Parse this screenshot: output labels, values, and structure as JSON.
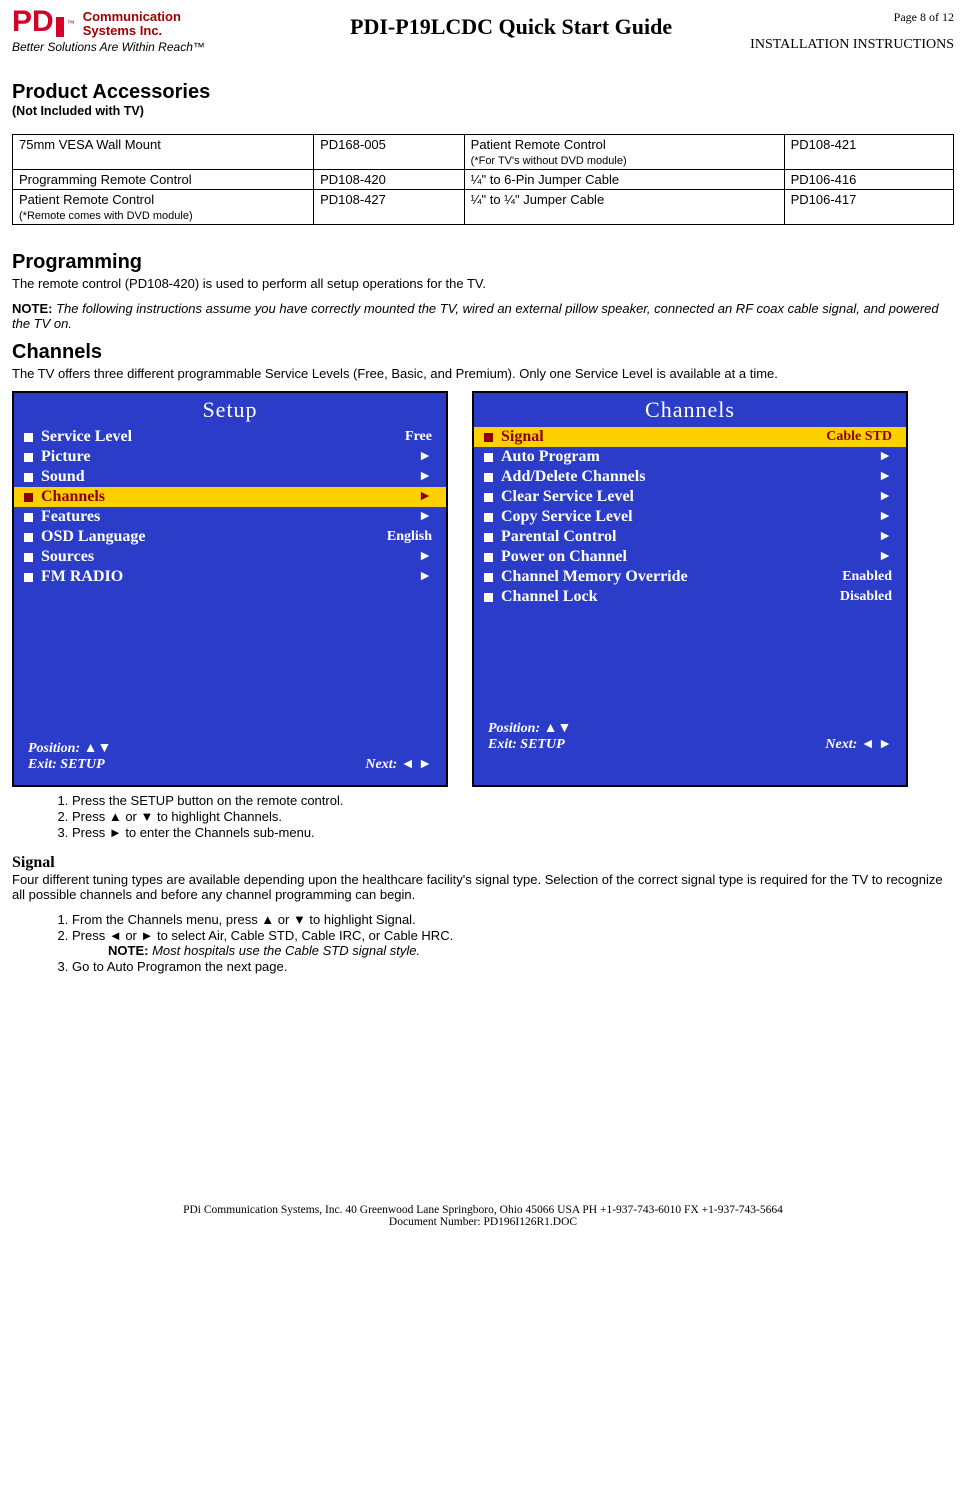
{
  "header": {
    "brand_line1": "Communication",
    "brand_line2": "Systems Inc.",
    "tagline": "Better Solutions Are Within Reach™",
    "title": "PDI-P19LCDC Quick Start Guide",
    "page": "Page 8 of 12",
    "section": "INSTALLATION INSTRUCTIONS"
  },
  "accessories": {
    "heading": "Product Accessories",
    "subheading": "(Not Included with TV)",
    "rows": [
      {
        "c0_name": "75mm VESA Wall Mount",
        "c0_note": "",
        "c1": "PD168-005",
        "c2_name": "Patient Remote Control",
        "c2_note": "(*For TV's without DVD module)",
        "c3": "PD108-421"
      },
      {
        "c0_name": "Programming Remote Control",
        "c0_note": "",
        "c1": "PD108-420",
        "c2_name": "¼\" to 6-Pin Jumper Cable",
        "c2_note": "",
        "c3": "PD106-416"
      },
      {
        "c0_name": "Patient Remote Control",
        "c0_note": "(*Remote comes with DVD module)",
        "c1": "PD108-427",
        "c2_name": "¼\" to ¼\" Jumper Cable",
        "c2_note": "",
        "c3": "PD106-417"
      }
    ]
  },
  "programming": {
    "heading": "Programming",
    "text": "The remote control (PD108-420) is used to perform all setup operations for the TV.",
    "note_label": "NOTE:",
    "note_text": "The following instructions assume you have correctly mounted the TV, wired an external pillow speaker, connected an RF coax cable signal, and powered the TV on."
  },
  "channels": {
    "heading": "Channels",
    "text": "The TV offers three different programmable Service Levels (Free, Basic, and Premium). Only one Service Level is available at a time."
  },
  "setup_menu": {
    "title": "Setup",
    "items": [
      {
        "label": "Service Level",
        "value": "Free",
        "highlight": false
      },
      {
        "label": "Picture",
        "value": "►",
        "highlight": false
      },
      {
        "label": "Sound",
        "value": "►",
        "highlight": false
      },
      {
        "label": "Channels",
        "value": "►",
        "highlight": true
      },
      {
        "label": "Features",
        "value": "►",
        "highlight": false
      },
      {
        "label": "OSD Language",
        "value": "English",
        "highlight": false
      },
      {
        "label": "Sources",
        "value": "►",
        "highlight": false
      },
      {
        "label": "FM RADIO",
        "value": "►",
        "highlight": false
      }
    ],
    "footer_pos": "Position: ▲▼",
    "footer_exit": "Exit: SETUP",
    "footer_next": "Next: ◄ ►"
  },
  "channels_menu": {
    "title": "Channels",
    "items": [
      {
        "label": "Signal",
        "value": "Cable STD",
        "highlight": true
      },
      {
        "label": "Auto Program",
        "value": "►",
        "highlight": false
      },
      {
        "label": "Add/Delete Channels",
        "value": "►",
        "highlight": false
      },
      {
        "label": "Clear Service Level",
        "value": "►",
        "highlight": false
      },
      {
        "label": "Copy Service Level",
        "value": "►",
        "highlight": false
      },
      {
        "label": "Parental Control",
        "value": "►",
        "highlight": false
      },
      {
        "label": "Power on Channel",
        "value": "►",
        "highlight": false
      },
      {
        "label": "Channel Memory Override",
        "value": "Enabled",
        "highlight": false
      },
      {
        "label": "Channel Lock",
        "value": "Disabled",
        "highlight": false
      }
    ],
    "footer_pos": "Position: ▲▼",
    "footer_exit": "Exit: SETUP",
    "footer_next": "Next: ◄ ►"
  },
  "steps1": [
    "Press the SETUP button on the remote control.",
    "Press ▲ or ▼ to highlight Channels.",
    "Press ► to enter the Channels sub-menu."
  ],
  "signal": {
    "heading": "Signal",
    "text": "Four different tuning types are available depending upon the healthcare facility's signal type. Selection of the correct signal type is required for the TV to recognize all possible channels and before any channel programming can begin.",
    "steps": [
      "From the Channels menu, press ▲ or ▼ to highlight Signal.",
      "Press ◄ or ► to select Air, Cable STD, Cable IRC, or Cable HRC.",
      "Go to Auto Programon the next page."
    ],
    "step2_note_label": "NOTE:",
    "step2_note_text": "Most hospitals use the Cable STD signal style."
  },
  "footer": {
    "line1": "PDi Communication Systems, Inc.   40 Greenwood Lane   Springboro, Ohio 45066 USA   PH +1-937-743-6010  FX +1-937-743-5664",
    "line2": "Document Number:  PD196I126R1.DOC"
  }
}
